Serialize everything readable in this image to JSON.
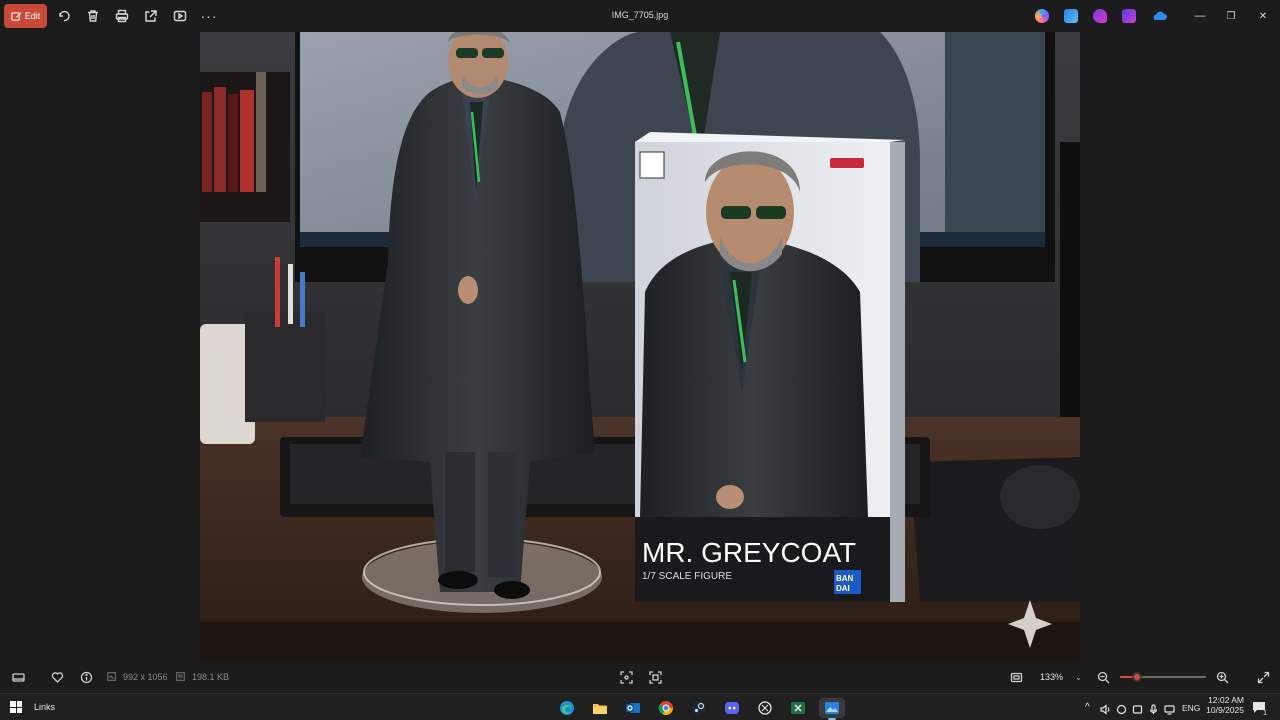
{
  "toolbar": {
    "edit_label": "Edit",
    "icons": [
      "rotate-icon",
      "delete-icon",
      "print-icon",
      "share-icon",
      "slideshow-icon",
      "more-icon"
    ],
    "file_name": "IMG_7705.jpg",
    "more_label": "···"
  },
  "titlebar_apps": [
    "copilot-icon",
    "photos-editor-icon",
    "clipchamp-icon",
    "designer-icon",
    "onedrive-icon"
  ],
  "window_controls": {
    "minimize": "—",
    "maximize": "❐",
    "close": "✕"
  },
  "photo": {
    "description_visible_text": "MR. GREYCOAT",
    "box_subtitle": "1/7 SCALE FIGURE",
    "brand": "BAN DAI",
    "colors": {
      "coat": "#2b2e30",
      "tie_stripe": "#3cbf5a",
      "desk": "#3a2a22",
      "box_white": "#e8eaee"
    }
  },
  "bottom": {
    "dimensions": "992 x 1056",
    "file_size": "198.1 KB",
    "zoom": "133%",
    "zoom_level": 0.2
  },
  "taskbar": {
    "links_label": "Links",
    "time": "12:02 AM",
    "date": "10/9/2025",
    "lang": "ENG",
    "notification_count": "1",
    "apps": [
      "edge-icon",
      "file-explorer-icon",
      "outlook-icon",
      "chrome-icon",
      "steam-icon",
      "discord-icon",
      "chatgpt-icon",
      "excel-icon",
      "photos-icon"
    ]
  }
}
